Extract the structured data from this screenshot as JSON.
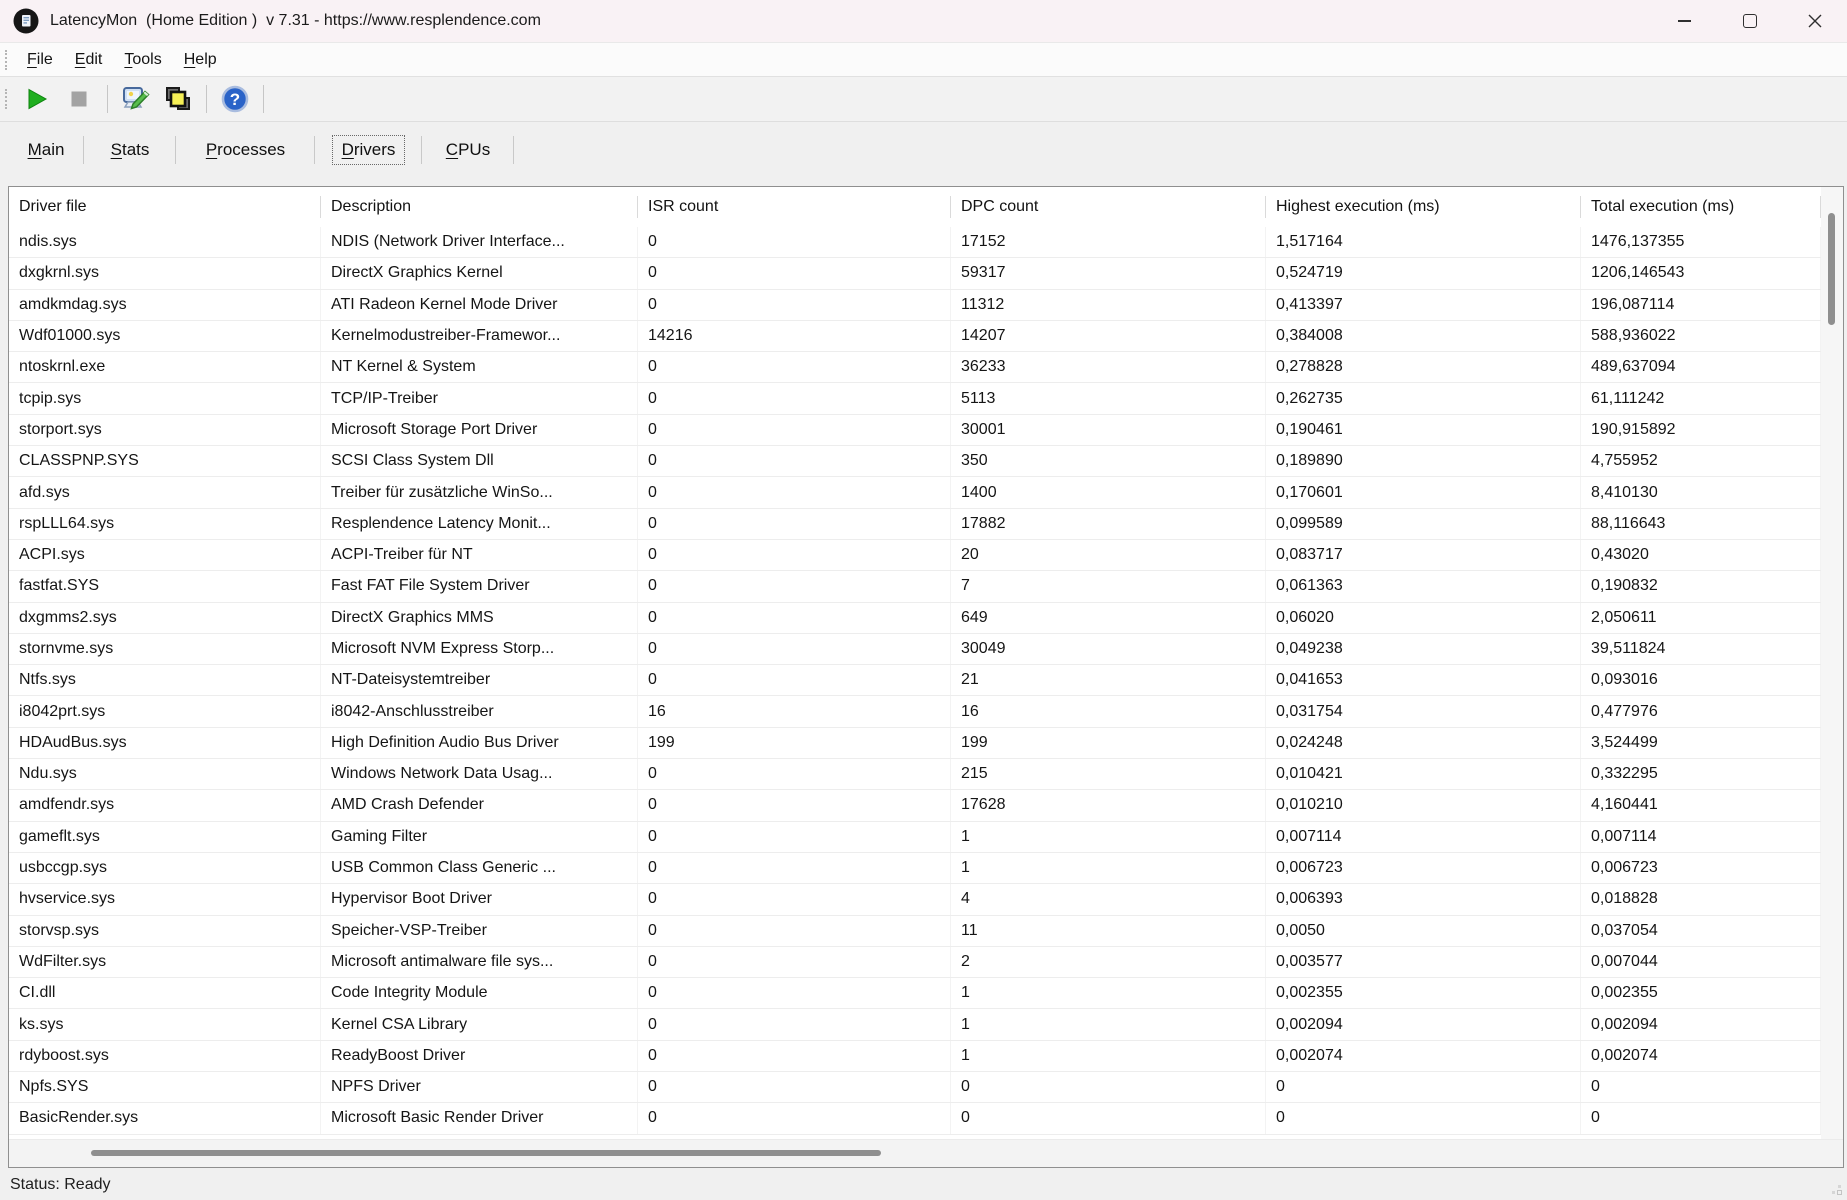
{
  "window": {
    "title": "LatencyMon  (Home Edition )  v 7.31 - https://www.resplendence.com"
  },
  "menu": {
    "items": [
      {
        "label": "File"
      },
      {
        "label": "Edit"
      },
      {
        "label": "Tools"
      },
      {
        "label": "Help"
      }
    ]
  },
  "toolbar": {
    "help_glyph": "?",
    "buttons": [
      {
        "name": "start-monitor",
        "icon": "play-icon"
      },
      {
        "name": "stop-monitor",
        "icon": "stop-icon"
      },
      {
        "name": "options",
        "icon": "monitor-pencil-icon"
      },
      {
        "name": "copy-report",
        "icon": "stacked-squares-icon"
      },
      {
        "name": "help",
        "icon": "question-mark-icon"
      }
    ]
  },
  "tabs": [
    {
      "label": "Main",
      "selected": false
    },
    {
      "label": "Stats",
      "selected": false
    },
    {
      "label": "Processes",
      "selected": false
    },
    {
      "label": "Drivers",
      "selected": true
    },
    {
      "label": "CPUs",
      "selected": false
    }
  ],
  "table": {
    "columns": [
      "Driver file",
      "Description",
      "ISR count",
      "DPC count",
      "Highest execution (ms)",
      "Total execution (ms)"
    ],
    "rows": [
      [
        "ndis.sys",
        "NDIS (Network Driver Interface...",
        "0",
        "17152",
        "1,517164",
        "1476,137355"
      ],
      [
        "dxgkrnl.sys",
        "DirectX Graphics Kernel",
        "0",
        "59317",
        "0,524719",
        "1206,146543"
      ],
      [
        "amdkmdag.sys",
        "ATI Radeon Kernel Mode Driver",
        "0",
        "11312",
        "0,413397",
        "196,087114"
      ],
      [
        "Wdf01000.sys",
        "Kernelmodustreiber-Framewor...",
        "14216",
        "14207",
        "0,384008",
        "588,936022"
      ],
      [
        "ntoskrnl.exe",
        "NT Kernel & System",
        "0",
        "36233",
        "0,278828",
        "489,637094"
      ],
      [
        "tcpip.sys",
        "TCP/IP-Treiber",
        "0",
        "5113",
        "0,262735",
        "61,111242"
      ],
      [
        "storport.sys",
        "Microsoft Storage Port Driver",
        "0",
        "30001",
        "0,190461",
        "190,915892"
      ],
      [
        "CLASSPNP.SYS",
        "SCSI Class System Dll",
        "0",
        "350",
        "0,189890",
        "4,755952"
      ],
      [
        "afd.sys",
        "Treiber für zusätzliche WinSo...",
        "0",
        "1400",
        "0,170601",
        "8,410130"
      ],
      [
        "rspLLL64.sys",
        "Resplendence Latency Monit...",
        "0",
        "17882",
        "0,099589",
        "88,116643"
      ],
      [
        "ACPI.sys",
        "ACPI-Treiber für NT",
        "0",
        "20",
        "0,083717",
        "0,43020"
      ],
      [
        "fastfat.SYS",
        "Fast FAT File System Driver",
        "0",
        "7",
        "0,061363",
        "0,190832"
      ],
      [
        "dxgmms2.sys",
        "DirectX Graphics MMS",
        "0",
        "649",
        "0,06020",
        "2,050611"
      ],
      [
        "stornvme.sys",
        "Microsoft NVM Express Storp...",
        "0",
        "30049",
        "0,049238",
        "39,511824"
      ],
      [
        "Ntfs.sys",
        "NT-Dateisystemtreiber",
        "0",
        "21",
        "0,041653",
        "0,093016"
      ],
      [
        "i8042prt.sys",
        "i8042-Anschlusstreiber",
        "16",
        "16",
        "0,031754",
        "0,477976"
      ],
      [
        "HDAudBus.sys",
        "High Definition Audio Bus Driver",
        "199",
        "199",
        "0,024248",
        "3,524499"
      ],
      [
        "Ndu.sys",
        "Windows Network Data Usag...",
        "0",
        "215",
        "0,010421",
        "0,332295"
      ],
      [
        "amdfendr.sys",
        "AMD Crash Defender",
        "0",
        "17628",
        "0,010210",
        "4,160441"
      ],
      [
        "gameflt.sys",
        "Gaming Filter",
        "0",
        "1",
        "0,007114",
        "0,007114"
      ],
      [
        "usbccgp.sys",
        "USB Common Class Generic ...",
        "0",
        "1",
        "0,006723",
        "0,006723"
      ],
      [
        "hvservice.sys",
        "Hypervisor Boot Driver",
        "0",
        "4",
        "0,006393",
        "0,018828"
      ],
      [
        "storvsp.sys",
        "Speicher-VSP-Treiber",
        "0",
        "11",
        "0,0050",
        "0,037054"
      ],
      [
        "WdFilter.sys",
        "Microsoft antimalware file sys...",
        "0",
        "2",
        "0,003577",
        "0,007044"
      ],
      [
        "CI.dll",
        "Code Integrity Module",
        "0",
        "1",
        "0,002355",
        "0,002355"
      ],
      [
        "ks.sys",
        "Kernel CSA Library",
        "0",
        "1",
        "0,002094",
        "0,002094"
      ],
      [
        "rdyboost.sys",
        "ReadyBoost Driver",
        "0",
        "1",
        "0,002074",
        "0,002074"
      ],
      [
        "Npfs.SYS",
        "NPFS Driver",
        "0",
        "0",
        "0",
        "0"
      ],
      [
        "BasicRender.sys",
        "Microsoft Basic Render Driver",
        "0",
        "0",
        "0",
        "0"
      ]
    ]
  },
  "statusbar": {
    "text": "Status: Ready"
  },
  "colors": {
    "titlebar": "#f9f2f5",
    "chrome": "#f0f0f0",
    "play_green": "#1fae1f",
    "stop_gray": "#a3a3a3",
    "help_blue": "#2a63c8",
    "copy_yellow": "#f5ef56",
    "scroll_thumb": "#8f8f8f"
  }
}
